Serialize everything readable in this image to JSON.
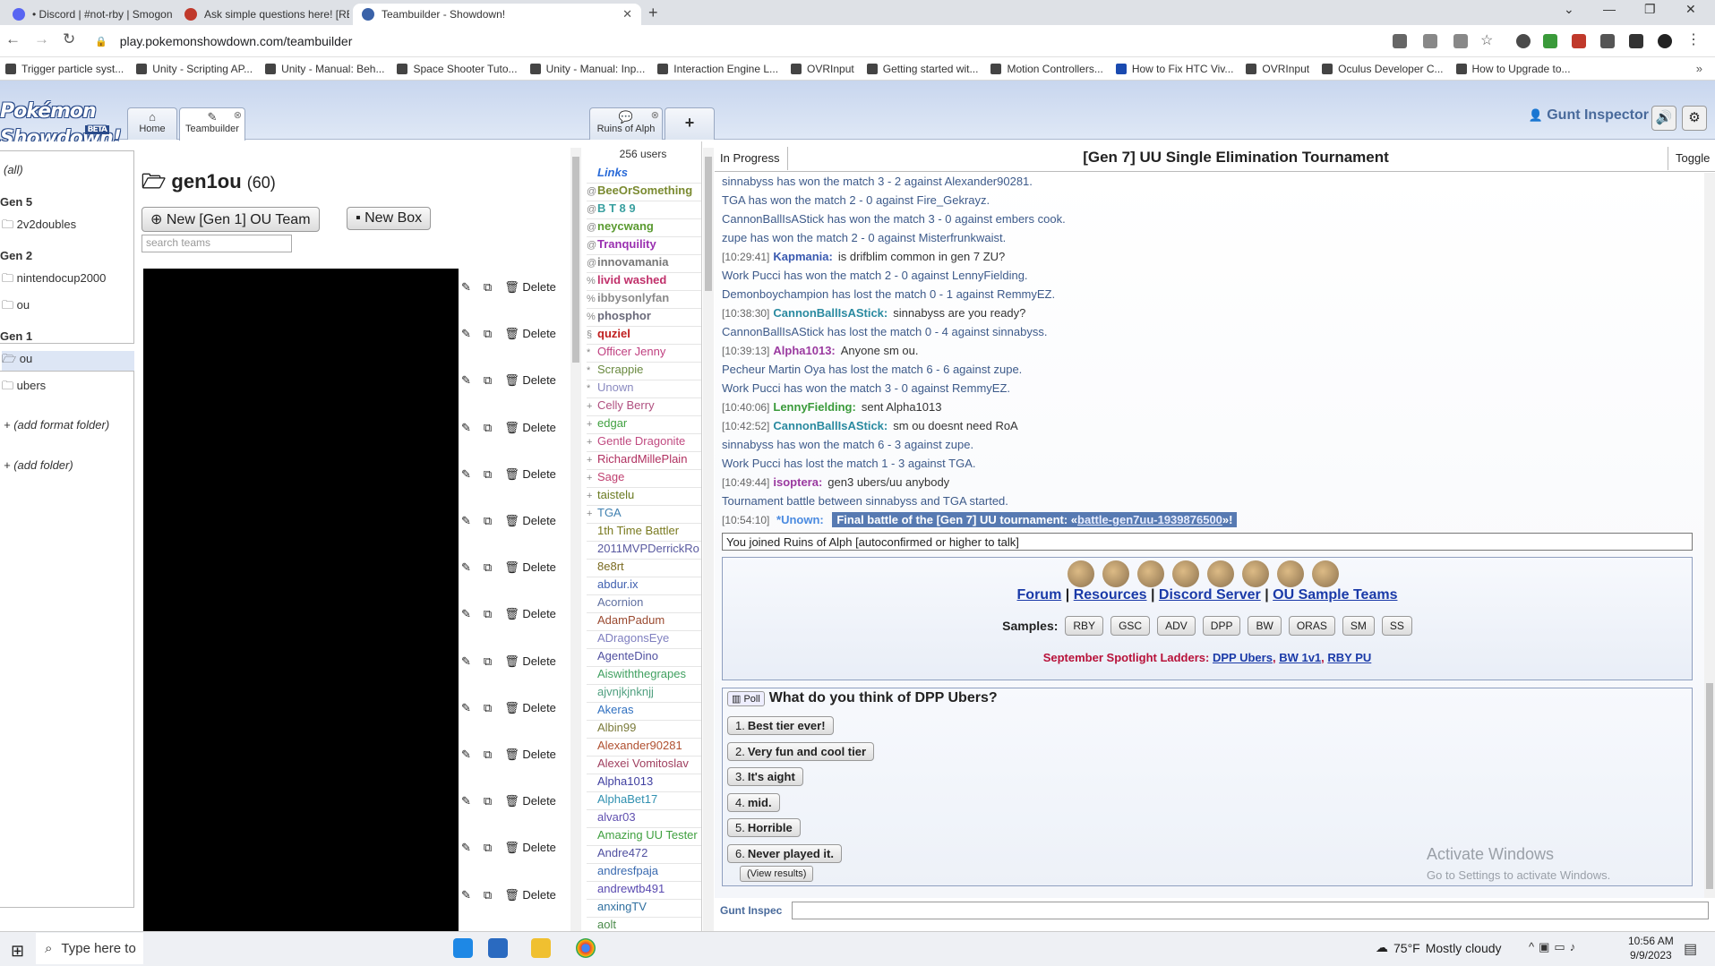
{
  "browser": {
    "tabs": [
      {
        "title": "• Discord | #not-rby | Smogon R",
        "color": "#5865f2"
      },
      {
        "title": "Ask simple questions here! [REA",
        "color": "#c0392b"
      },
      {
        "title": "Teambuilder - Showdown!",
        "color": "#3a62a8"
      }
    ],
    "new_tab": "+",
    "url": "play.pokemonshowdown.com/teambuilder",
    "bookmarks": [
      "Trigger particle syst...",
      "Unity - Scripting AP...",
      "Unity - Manual: Beh...",
      "Space Shooter Tuto...",
      "Unity - Manual: Inp...",
      "Interaction Engine L...",
      "OVRInput",
      "Getting started wit...",
      "Motion Controllers...",
      "How to Fix HTC Viv...",
      "OVRInput",
      "Oculus Developer C...",
      "How to Upgrade to..."
    ]
  },
  "showdown": {
    "logo": "Pokémon Showdown!",
    "beta": "BETA",
    "tabs": {
      "home": "Home",
      "teambuilder": "Teambuilder",
      "room": "Ruins of Alph",
      "add": "+"
    },
    "username": "Gunt Inspector"
  },
  "folders": {
    "all": "(all)",
    "gen5": "Gen 5",
    "f_2v2doubles": "2v2doubles",
    "gen2": "Gen 2",
    "f_nintendocup2000": "nintendocup2000",
    "f_ou_gen2": "ou",
    "gen1": "Gen 1",
    "f_ou_gen1": "ou",
    "f_ubers": "ubers",
    "add_format_folder": "(add format folder)",
    "add_folder": "(add folder)"
  },
  "teams": {
    "folder_name": "gen1ou",
    "count": "(60)",
    "new_team": "New [Gen 1] OU Team",
    "new_box": "New Box",
    "search_placeholder": "search teams",
    "delete_label": "Delete",
    "row_count": 14
  },
  "userlist": {
    "count": "256 users",
    "users": [
      {
        "g": "",
        "name": "Links",
        "color": "#2a6bd8",
        "style": "italic-bold"
      },
      {
        "g": "@",
        "name": "BeeOrSomething",
        "color": "#7a8a30",
        "style": "bold"
      },
      {
        "g": "@",
        "name": "B T 8 9",
        "color": "#3aa0a0",
        "style": "bold"
      },
      {
        "g": "@",
        "name": "neycwang",
        "color": "#5a9a30",
        "style": "bold"
      },
      {
        "g": "@",
        "name": "Tranquility",
        "color": "#9a30b0",
        "style": "bold"
      },
      {
        "g": "@",
        "name": "innovamania",
        "color": "#777777",
        "style": "bold"
      },
      {
        "g": "%",
        "name": "livid washed",
        "color": "#c0306a",
        "style": "bold"
      },
      {
        "g": "%",
        "name": "ibbysonlyfan",
        "color": "#8a8a8a",
        "style": "bold"
      },
      {
        "g": "%",
        "name": "phosphor",
        "color": "#6a6a7a",
        "style": "bold"
      },
      {
        "g": "§",
        "name": "quziel",
        "color": "#c02020",
        "style": "bold"
      },
      {
        "g": "*",
        "name": "Officer Jenny",
        "color": "#c04080",
        "style": ""
      },
      {
        "g": "*",
        "name": "Scrappie",
        "color": "#6a8a40",
        "style": ""
      },
      {
        "g": "*",
        "name": "Unown",
        "color": "#8a8ac0",
        "style": ""
      },
      {
        "g": "+",
        "name": "Celly Berry",
        "color": "#b05080",
        "style": ""
      },
      {
        "g": "+",
        "name": "edgar",
        "color": "#40a040",
        "style": ""
      },
      {
        "g": "+",
        "name": "Gentle Dragonite",
        "color": "#c04a80",
        "style": ""
      },
      {
        "g": "+",
        "name": "RichardMillePlain",
        "color": "#b03060",
        "style": ""
      },
      {
        "g": "+",
        "name": "Sage",
        "color": "#c04070",
        "style": ""
      },
      {
        "g": "+",
        "name": "taistelu",
        "color": "#6a7a20",
        "style": ""
      },
      {
        "g": "+",
        "name": "TGA",
        "color": "#4080b0",
        "style": ""
      },
      {
        "g": "",
        "name": "1th Time Battler",
        "color": "#7a7a20",
        "style": ""
      },
      {
        "g": "",
        "name": "2011MVPDerrickRo",
        "color": "#5a5aa0",
        "style": ""
      },
      {
        "g": "",
        "name": "8e8rt",
        "color": "#7a6a20",
        "style": ""
      },
      {
        "g": "",
        "name": "abdur.ix",
        "color": "#4060b0",
        "style": ""
      },
      {
        "g": "",
        "name": "Acornion",
        "color": "#6070a0",
        "style": ""
      },
      {
        "g": "",
        "name": "AdamPadum",
        "color": "#9a4a30",
        "style": ""
      },
      {
        "g": "",
        "name": "ADragonsEye",
        "color": "#8080c0",
        "style": ""
      },
      {
        "g": "",
        "name": "AgenteDino",
        "color": "#5050a0",
        "style": ""
      },
      {
        "g": "",
        "name": "Aiswiththegrapes",
        "color": "#40a060",
        "style": ""
      },
      {
        "g": "",
        "name": "ajvnjkjnknjj",
        "color": "#50a080",
        "style": ""
      },
      {
        "g": "",
        "name": "Akeras",
        "color": "#3070c0",
        "style": ""
      },
      {
        "g": "",
        "name": "Albin99",
        "color": "#7a7a3a",
        "style": ""
      },
      {
        "g": "",
        "name": "Alexander90281",
        "color": "#b05030",
        "style": ""
      },
      {
        "g": "",
        "name": "Alexei Vomitoslav",
        "color": "#a04060",
        "style": ""
      },
      {
        "g": "",
        "name": "Alpha1013",
        "color": "#4040a0",
        "style": ""
      },
      {
        "g": "",
        "name": "AlphaBet17",
        "color": "#3090b0",
        "style": ""
      },
      {
        "g": "",
        "name": "alvar03",
        "color": "#6050b0",
        "style": ""
      },
      {
        "g": "",
        "name": "Amazing UU Tester",
        "color": "#40a040",
        "style": ""
      },
      {
        "g": "",
        "name": "Andre472",
        "color": "#5050a0",
        "style": ""
      },
      {
        "g": "",
        "name": "andresfpaja",
        "color": "#3a6ab0",
        "style": ""
      },
      {
        "g": "",
        "name": "andrewtb491",
        "color": "#5a4ab0",
        "style": ""
      },
      {
        "g": "",
        "name": "anxingTV",
        "color": "#3070a0",
        "style": ""
      },
      {
        "g": "",
        "name": "aolt",
        "color": "#4a8a4a",
        "style": ""
      }
    ]
  },
  "chat": {
    "status": "In Progress",
    "tournament_title": "[Gen 7] UU Single Elimination Tournament",
    "toggle": "Toggle",
    "log": [
      {
        "ts": "",
        "name": "",
        "text": "sinnabyss has won the match 3 - 2 against Alexander90281.",
        "kind": "ev"
      },
      {
        "ts": "",
        "name": "",
        "text": "TGA has won the match 2 - 0 against Fire_Gekrayz.",
        "kind": "ev"
      },
      {
        "ts": "",
        "name": "",
        "text": "CannonBallIsAStick has won the match 3 - 0 against embers cook.",
        "kind": "ev"
      },
      {
        "ts": "",
        "name": "",
        "text": "zupe has won the match 2 - 0 against Misterfrunkwaist.",
        "kind": "ev"
      },
      {
        "ts": "[10:29:41]",
        "name": "Kapmania:",
        "color": "#3a5ab0",
        "text": "is drifblim common in gen 7 ZU?",
        "kind": "msg"
      },
      {
        "ts": "",
        "name": "",
        "text": "Work Pucci has won the match 2 - 0 against LennyFielding.",
        "kind": "ev"
      },
      {
        "ts": "",
        "name": "",
        "text": "Demonboychampion has lost the match 0 - 1 against RemmyEZ.",
        "kind": "ev"
      },
      {
        "ts": "[10:38:30]",
        "name": "CannonBallIsAStick:",
        "color": "#2a8aa0",
        "text": "sinnabyss are you ready?",
        "kind": "msg"
      },
      {
        "ts": "",
        "name": "",
        "text": "CannonBallIsAStick has lost the match 0 - 4 against sinnabyss.",
        "kind": "ev"
      },
      {
        "ts": "[10:39:13]",
        "name": "Alpha1013:",
        "color": "#9a3aa0",
        "text": "Anyone sm ou.",
        "kind": "msg"
      },
      {
        "ts": "",
        "name": "",
        "text": "Pecheur Martin Oya has lost the match 6 - 6 against zupe.",
        "kind": "ev"
      },
      {
        "ts": "",
        "name": "",
        "text": "Work Pucci has won the match 3 - 0 against RemmyEZ.",
        "kind": "ev"
      },
      {
        "ts": "[10:40:06]",
        "name": "LennyFielding:",
        "color": "#3a9a3a",
        "text": "sent Alpha1013",
        "kind": "msg"
      },
      {
        "ts": "[10:42:52]",
        "name": "CannonBallIsAStick:",
        "color": "#2a8aa0",
        "text": "sm ou doesnt need RoA",
        "kind": "msg"
      },
      {
        "ts": "",
        "name": "",
        "text": "sinnabyss has won the match 6 - 3 against zupe.",
        "kind": "ev"
      },
      {
        "ts": "",
        "name": "",
        "text": "Work Pucci has lost the match 1 - 3 against TGA.",
        "kind": "ev"
      },
      {
        "ts": "[10:49:44]",
        "name": "isoptera:",
        "color": "#9a3aa0",
        "text": "gen3 ubers/uu anybody",
        "kind": "msg"
      },
      {
        "ts": "",
        "name": "",
        "text": "Tournament battle between sinnabyss and TGA started.",
        "kind": "ev"
      }
    ],
    "final_line": {
      "ts": "[10:54:10]",
      "name": "*Unown:",
      "text": "Final battle of the [Gen 7] UU tournament: «",
      "link": "battle-gen7uu-1939876500",
      "end": "»!"
    },
    "joined": "You joined Ruins of Alph [autoconfirmed or higher to talk]",
    "links": {
      "forum": "Forum",
      "resources": "Resources",
      "discord": "Discord Server",
      "samples_link": "OU Sample Teams",
      "sep": "|"
    },
    "samples_label": "Samples:",
    "samples": [
      "RBY",
      "GSC",
      "ADV",
      "DPP",
      "BW",
      "ORAS",
      "SM",
      "SS"
    ],
    "spotlight_label": "September Spotlight Ladders:",
    "spotlight": [
      "DPP Ubers",
      "BW 1v1",
      "RBY PU"
    ],
    "poll": {
      "badge": "Poll",
      "question": "What do you think of DPP Ubers?",
      "options": [
        {
          "n": "1.",
          "label": "Best tier ever!"
        },
        {
          "n": "2.",
          "label": "Very fun and cool tier"
        },
        {
          "n": "3.",
          "label": "It's aight"
        },
        {
          "n": "4.",
          "label": "mid."
        },
        {
          "n": "5.",
          "label": "Horrible"
        },
        {
          "n": "6.",
          "label": "Never played it."
        }
      ],
      "view_results": "(View results)"
    },
    "watermark_title": "Activate Windows",
    "watermark_sub": "Go to Settings to activate Windows.",
    "input_name": "Gunt Inspec"
  },
  "taskbar": {
    "search": "Type here to",
    "weather_temp": "75°F",
    "weather_desc": "Mostly cloudy",
    "time": "10:56 AM",
    "date": "9/9/2023"
  }
}
